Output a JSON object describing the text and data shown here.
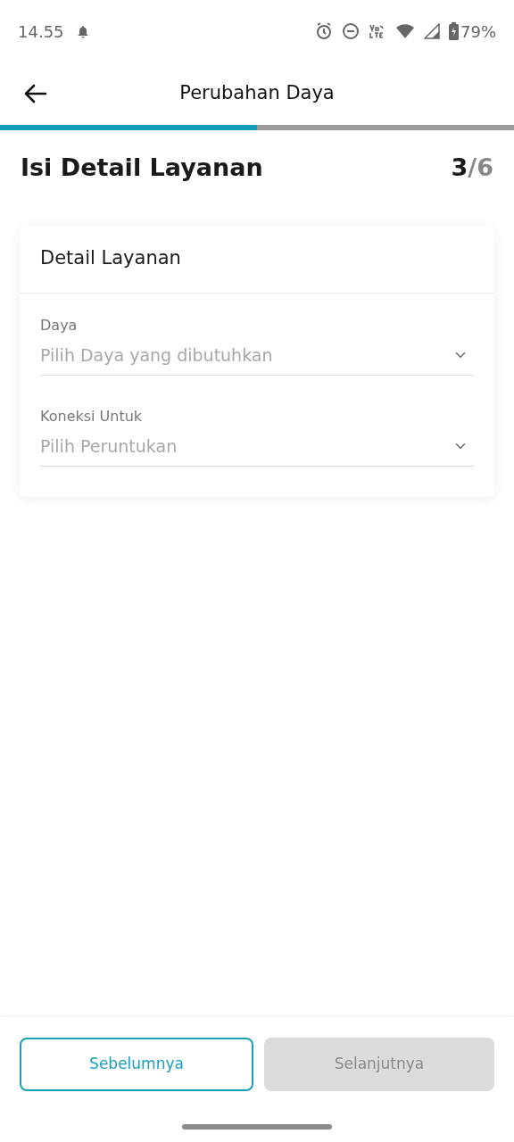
{
  "status_bar": {
    "time": "14.55",
    "battery": "79%"
  },
  "header": {
    "title": "Perubahan Daya"
  },
  "progress": {
    "level": 0.5
  },
  "page": {
    "title": "Isi Detail Layanan",
    "step": "3",
    "total": "/6"
  },
  "card": {
    "title": "Detail Layanan",
    "fields": [
      {
        "label": "Daya",
        "placeholder": "Pilih Daya yang dibutuhkan"
      },
      {
        "label": "Koneksi Untuk",
        "placeholder": "Pilih Peruntukan"
      }
    ]
  },
  "buttons": [
    {
      "label": "Sebelumnya",
      "disabled": false
    },
    {
      "label": "Selanjutnya",
      "disabled": true
    }
  ]
}
